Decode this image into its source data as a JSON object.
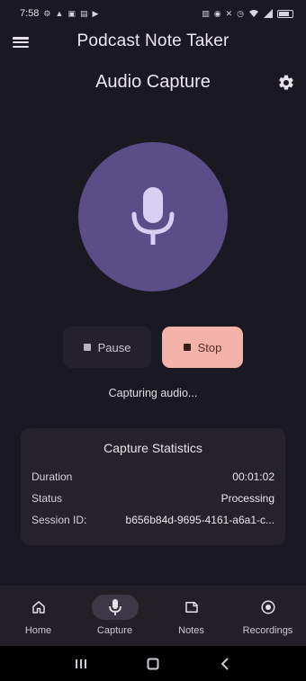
{
  "status_bar": {
    "time": "7:58",
    "left_icons": [
      "settings-icon",
      "notification-icon",
      "clipboard-icon",
      "media-icon",
      "play-icon"
    ],
    "right_icons": [
      "vibrate-icon",
      "data-icon",
      "mute-icon",
      "alarm-icon",
      "wifi-icon",
      "signal-icon",
      "battery-icon"
    ]
  },
  "app_bar": {
    "title": "Podcast Note Taker"
  },
  "screen": {
    "title": "Audio Capture"
  },
  "controls": {
    "pause_label": "Pause",
    "stop_label": "Stop"
  },
  "capture_status_text": "Capturing audio...",
  "stats": {
    "title": "Capture Statistics",
    "rows": [
      {
        "label": "Duration",
        "value": "00:01:02"
      },
      {
        "label": "Status",
        "value": "Processing"
      },
      {
        "label": "Session ID:",
        "value": "b656b84d-9695-4161-a6a1-c..."
      }
    ]
  },
  "bottom_nav": {
    "items": [
      {
        "label": "Home",
        "icon": "home-icon",
        "active": false
      },
      {
        "label": "Capture",
        "icon": "mic-icon",
        "active": true
      },
      {
        "label": "Notes",
        "icon": "notes-icon",
        "active": false
      },
      {
        "label": "Recordings",
        "icon": "recordings-icon",
        "active": false
      }
    ]
  },
  "colors": {
    "background": "#1a1820",
    "mic_circle": "#5b4e88",
    "mic_icon": "#d9cff5",
    "stop_button": "#f4b3aa",
    "card": "#25222a",
    "nav_bar": "#221f27"
  }
}
